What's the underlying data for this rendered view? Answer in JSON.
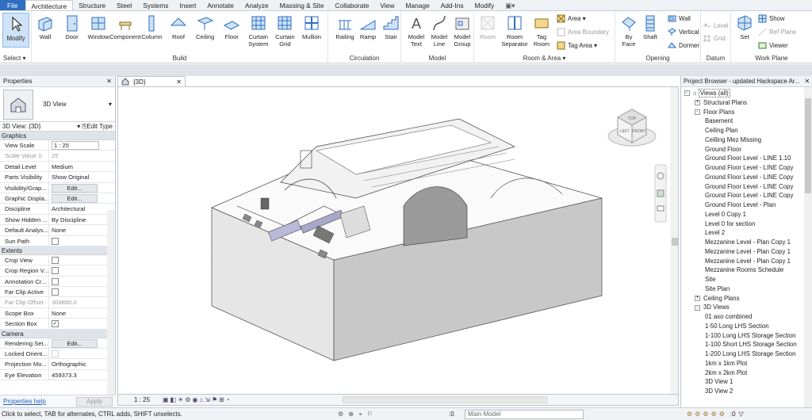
{
  "ribbon_tabs": [
    "File",
    "Architecture",
    "Structure",
    "Steel",
    "Systems",
    "Insert",
    "Annotate",
    "Analyze",
    "Massing & Site",
    "Collaborate",
    "View",
    "Manage",
    "Add-Ins",
    "Modify"
  ],
  "active_tab": "Architecture",
  "groups": {
    "select": {
      "label": "Select",
      "modify": "Modify"
    },
    "build": {
      "label": "Build",
      "tools": [
        "Wall",
        "Door",
        "Window",
        "Component",
        "Column",
        "Roof",
        "Ceiling",
        "Floor",
        "Curtain\nSystem",
        "Curtain\nGrid",
        "Mullion"
      ]
    },
    "circulation": {
      "label": "Circulation",
      "tools": [
        "Railing",
        "Ramp",
        "Stair"
      ]
    },
    "model": {
      "label": "Model",
      "tools": [
        "Model\nText",
        "Model\nLine",
        "Model\nGroup"
      ]
    },
    "room_area": {
      "label": "Room & Area",
      "tools": [
        "Room",
        "Room\nSeparator",
        "Tag\nRoom"
      ],
      "small": [
        "Area",
        "Area  Boundary",
        "Tag  Area"
      ]
    },
    "opening": {
      "label": "Opening",
      "tools": [
        "By\nFace",
        "Shaft"
      ],
      "small": [
        "Wall",
        "Vertical",
        "Dormer"
      ]
    },
    "datum": {
      "label": "Datum",
      "small": [
        "Level",
        "Grid"
      ]
    },
    "work_plane": {
      "label": "Work Plane",
      "tool": "Set",
      "small": [
        "Show",
        "Ref  Plane",
        "Viewer"
      ]
    }
  },
  "properties": {
    "title": "Properties",
    "type_name": "3D View",
    "selector": "3D View: {3D}",
    "edit_type": "Edit Type",
    "sections": [
      {
        "name": "Graphics",
        "rows": [
          {
            "k": "View Scale",
            "v": "1 : 25",
            "kind": "input"
          },
          {
            "k": "Scale Value   1:",
            "v": "25",
            "kind": "dis"
          },
          {
            "k": "Detail Level",
            "v": "Medium"
          },
          {
            "k": "Parts Visibility",
            "v": "Show Original"
          },
          {
            "k": "Visibility/Grap...",
            "v": "Edit...",
            "kind": "btn"
          },
          {
            "k": "Graphic Displa...",
            "v": "Edit...",
            "kind": "btn"
          },
          {
            "k": "Discipline",
            "v": "Architectural"
          },
          {
            "k": "Show Hidden ...",
            "v": "By Discipline"
          },
          {
            "k": "Default Analys...",
            "v": "None"
          },
          {
            "k": "Sun Path",
            "v": "",
            "kind": "cb"
          }
        ]
      },
      {
        "name": "Extents",
        "rows": [
          {
            "k": "Crop View",
            "v": "",
            "kind": "cb"
          },
          {
            "k": "Crop Region V...",
            "v": "",
            "kind": "cb"
          },
          {
            "k": "Annotation Cr...",
            "v": "",
            "kind": "cb"
          },
          {
            "k": "Far Clip Active",
            "v": "",
            "kind": "cb"
          },
          {
            "k": "Far Clip Offset",
            "v": "304800.0",
            "kind": "dis"
          },
          {
            "k": "Scope Box",
            "v": "None"
          },
          {
            "k": "Section Box",
            "v": "✓",
            "kind": "cbchk"
          }
        ]
      },
      {
        "name": "Camera",
        "rows": [
          {
            "k": "Rendering Set...",
            "v": "Edit...",
            "kind": "btn"
          },
          {
            "k": "Locked Orient...",
            "v": "",
            "kind": "cbdis"
          },
          {
            "k": "Projection Mo...",
            "v": "Orthographic"
          },
          {
            "k": "Eye Elevation",
            "v": "459373.3"
          }
        ]
      }
    ],
    "help": "Properties help",
    "apply": "Apply"
  },
  "view": {
    "tab": "{3D}",
    "scale": "1 : 25",
    "viewcube": [
      "TOP",
      "FRONT",
      "LEFT"
    ]
  },
  "browser": {
    "title": "Project Browser - updated Hackspace Ar...",
    "items": [
      {
        "t": "Views (all)",
        "lvl": 0,
        "tg": "-",
        "sel": true
      },
      {
        "t": "Structural Plans",
        "lvl": 1,
        "tg": "+"
      },
      {
        "t": "Floor Plans",
        "lvl": 1,
        "tg": "-"
      },
      {
        "t": "Basement",
        "lvl": 2
      },
      {
        "t": "Ceiling Plan",
        "lvl": 2
      },
      {
        "t": "Ceilling Mez Missing",
        "lvl": 2
      },
      {
        "t": "Ground Floor",
        "lvl": 2
      },
      {
        "t": "Ground Floor Level - LINE 1.10",
        "lvl": 2
      },
      {
        "t": "Ground Floor Level - LINE Copy",
        "lvl": 2
      },
      {
        "t": "Ground Floor Level - LINE Copy",
        "lvl": 2
      },
      {
        "t": "Ground Floor Level - LINE Copy",
        "lvl": 2
      },
      {
        "t": "Ground Floor Level - LINE Copy",
        "lvl": 2
      },
      {
        "t": "Ground Floor Level - Plan",
        "lvl": 2
      },
      {
        "t": "Level 0 Copy 1",
        "lvl": 2
      },
      {
        "t": "Level 0 for section",
        "lvl": 2
      },
      {
        "t": "Level 2",
        "lvl": 2
      },
      {
        "t": "Mezzanine Level - Plan Copy 1",
        "lvl": 2
      },
      {
        "t": "Mezzanine Level - Plan Copy 1",
        "lvl": 2
      },
      {
        "t": "Mezzanine Level - Plan Copy 1",
        "lvl": 2
      },
      {
        "t": "Mezzanine Rooms Schedule",
        "lvl": 2
      },
      {
        "t": "Site",
        "lvl": 2
      },
      {
        "t": "Site Plan",
        "lvl": 2
      },
      {
        "t": "Ceiling Plans",
        "lvl": 1,
        "tg": "+"
      },
      {
        "t": "3D Views",
        "lvl": 1,
        "tg": "-"
      },
      {
        "t": "01 axo combined",
        "lvl": 2
      },
      {
        "t": "1-50 Long LHS Section",
        "lvl": 2
      },
      {
        "t": "1-100 Long LHS Storage Section",
        "lvl": 2
      },
      {
        "t": "1-100 Short LHS Storage Section",
        "lvl": 2
      },
      {
        "t": "1-200 Long LHS Storage Section",
        "lvl": 2
      },
      {
        "t": "1km x 1km Plot",
        "lvl": 2
      },
      {
        "t": "2km x 2km Plot",
        "lvl": 2
      },
      {
        "t": "3D View 1",
        "lvl": 2
      },
      {
        "t": "3D View 2",
        "lvl": 2
      }
    ]
  },
  "status": {
    "message": "Click to select, TAB for alternates, CTRL adds, SHIFT unselects.",
    "zero1": ":0",
    "model": "Main Model",
    "zero2": ":0"
  }
}
